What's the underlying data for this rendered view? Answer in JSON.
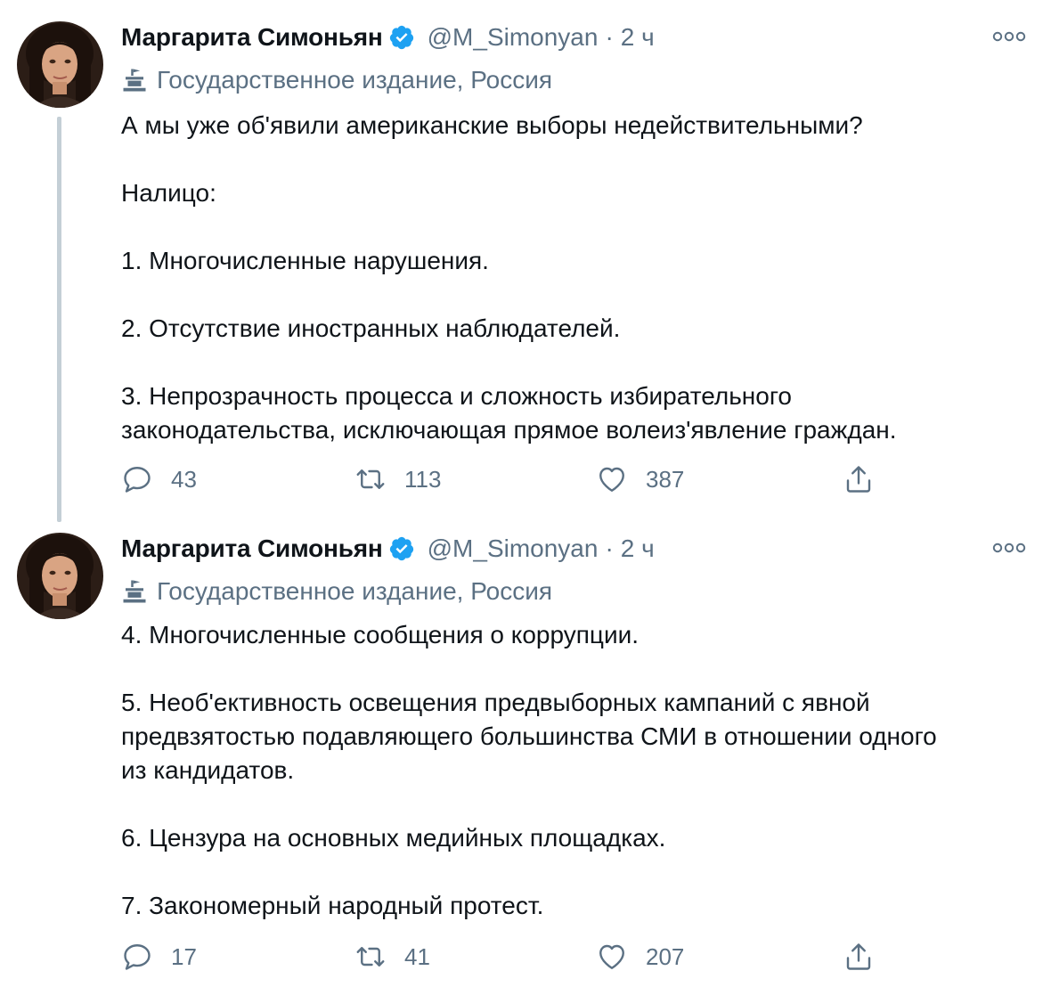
{
  "tweets": [
    {
      "author_name": "Маргарита Симоньян",
      "handle": "@M_Simonyan",
      "separator": "·",
      "time": "2 ч",
      "label": "Государственное издание, Россия",
      "paragraphs": [
        "А мы уже об'явили американские выборы недействительными?",
        "Налицо:",
        "1. Многочисленные нарушения.",
        "2. Отсутствие иностранных наблюдателей.",
        "3. Непрозрачность процесса и сложность избирательного\nзаконодательства, исключающая прямое волеиз'явление граждан."
      ],
      "replies": "43",
      "retweets": "113",
      "likes": "387"
    },
    {
      "author_name": "Маргарита Симоньян",
      "handle": "@M_Simonyan",
      "separator": "·",
      "time": "2 ч",
      "label": "Государственное издание, Россия",
      "paragraphs": [
        "4. Многочисленные сообщения о коррупции.",
        "5. Необ'ективность освещения предвыборных кампаний с явной\nпредвзятостью подавляющего большинства СМИ в отношении одного\nиз кандидатов.",
        "6. Цензура на основных медийных площадках.",
        "7. Закономерный народный протест."
      ],
      "replies": "17",
      "retweets": "41",
      "likes": "207"
    }
  ],
  "icons": {
    "verified": "verified-badge-icon",
    "more": "more-options-icon",
    "label": "state-media-icon",
    "reply": "reply-icon",
    "retweet": "retweet-icon",
    "like": "heart-icon",
    "share": "share-icon"
  },
  "colors": {
    "verified_blue": "#1da1f2",
    "secondary_text": "#5b7083",
    "primary_text": "#0f1419",
    "thread_line": "#c4cfd6"
  }
}
